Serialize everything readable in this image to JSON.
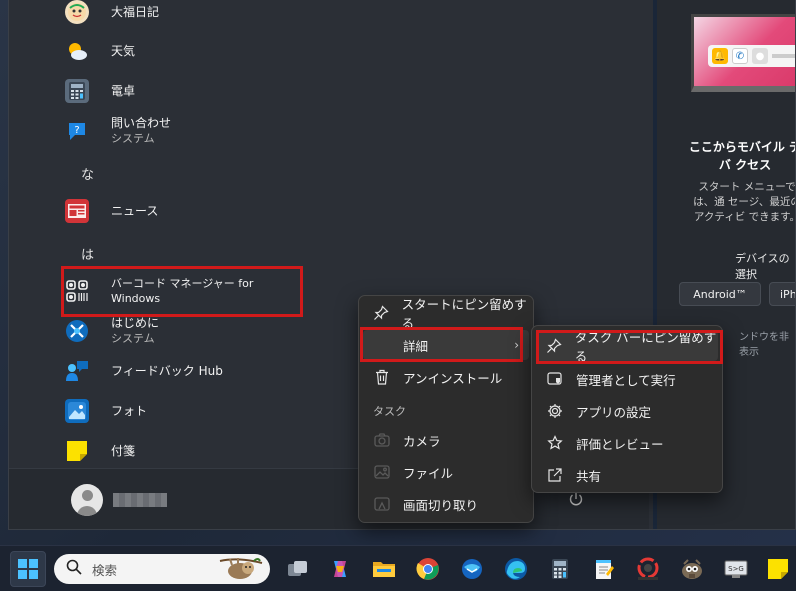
{
  "apps": [
    {
      "name": "大福日記",
      "sub": "",
      "icon": "face-icon"
    },
    {
      "name": "天気",
      "sub": "",
      "icon": "weather-icon"
    },
    {
      "name": "電卓",
      "sub": "",
      "icon": "calculator-icon"
    },
    {
      "name": "問い合わせ",
      "sub": "システム",
      "icon": "help-icon"
    },
    {
      "name": "ニュース",
      "sub": "",
      "icon": "news-icon"
    },
    {
      "name": "バーコード マネージャー for Windows",
      "sub": "",
      "icon": "barcode-icon"
    },
    {
      "name": "はじめに",
      "sub": "システム",
      "icon": "getstarted-icon"
    },
    {
      "name": "フィードバック Hub",
      "sub": "",
      "icon": "feedback-icon"
    },
    {
      "name": "フォト",
      "sub": "",
      "icon": "photos-icon"
    },
    {
      "name": "付箋",
      "sub": "",
      "icon": "sticky-notes-icon"
    }
  ],
  "letters": {
    "na": "な",
    "ha": "は"
  },
  "context_menu": {
    "pin_start": "スタートにピン留めする",
    "more": "詳細",
    "uninstall": "アンインストール",
    "tasks_header": "タスク",
    "tasks": [
      "カメラ",
      "ファイル",
      "画面切り取り"
    ]
  },
  "submenu": {
    "pin_taskbar": "タスク バーにピン留めする",
    "run_admin": "管理者として実行",
    "app_settings": "アプリの設定",
    "rate_review": "評価とレビュー",
    "share": "共有"
  },
  "phone_panel": {
    "title": "ここからモバイル デバ クセス",
    "desc": "スタート メニューでは、通 セージ、最近のアクティビ できます。",
    "choose": "デバイスの選択",
    "android": "Android™",
    "iphone": "iPh",
    "hide": "ンドウを非表示"
  },
  "taskbar": {
    "search_placeholder": "検索"
  },
  "colors": {
    "highlight": "#d11a1a",
    "accent": "#4cc2ff"
  }
}
